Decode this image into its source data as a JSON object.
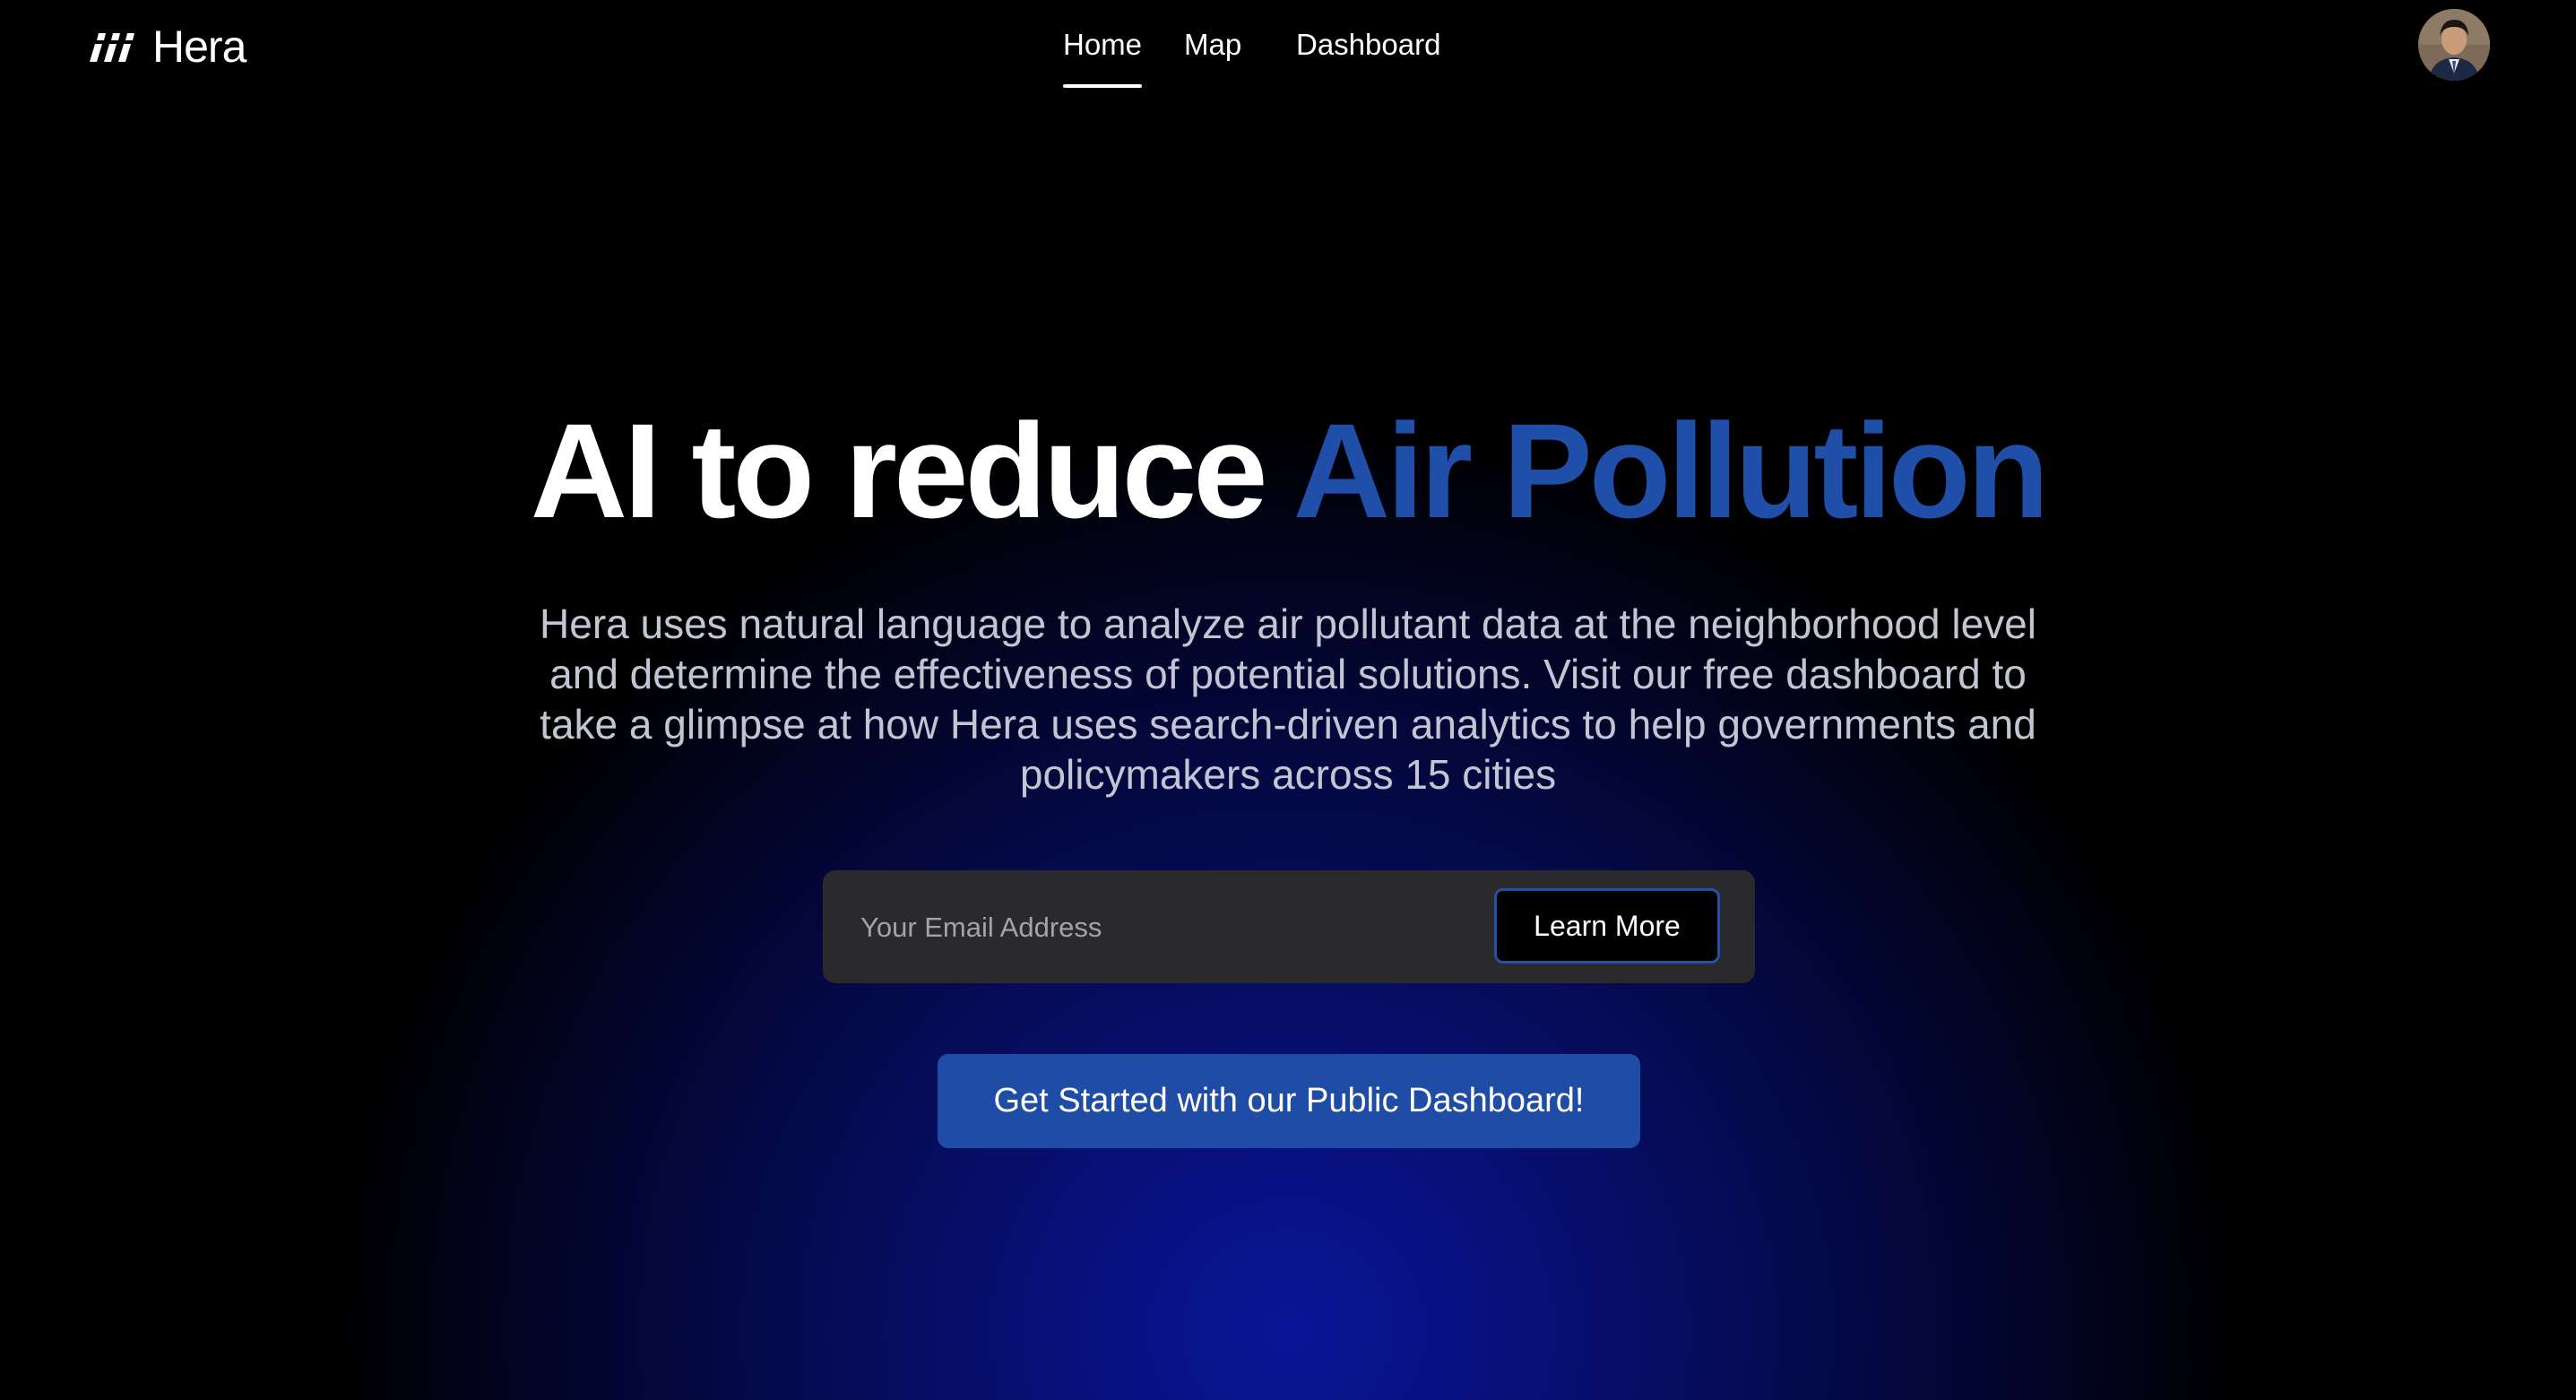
{
  "brand": {
    "name": "Hera",
    "logo_icon": "hera-logo-icon"
  },
  "nav": {
    "items": [
      {
        "label": "Home",
        "active": true
      },
      {
        "label": "Map",
        "active": false
      },
      {
        "label": "Dashboard",
        "active": false
      }
    ],
    "avatar_icon": "user-avatar"
  },
  "hero": {
    "title_main": "AI to reduce ",
    "title_accent": "Air Pollution",
    "description": "Hera uses natural language to analyze air pollutant data at the neighborhood level and determine the effectiveness of potential solutions. Visit our free dashboard to take a glimpse at how Hera uses search-driven analytics to help governments and policymakers across 15 cities"
  },
  "signup": {
    "email_placeholder": "Your Email Address",
    "email_value": "",
    "button_label": "Learn More"
  },
  "cta": {
    "label": "Get Started with our Public Dashboard!"
  },
  "colors": {
    "accent": "#1f4fa8",
    "button": "#1f4da5",
    "background": "#000000",
    "glow": "#0a1596"
  }
}
